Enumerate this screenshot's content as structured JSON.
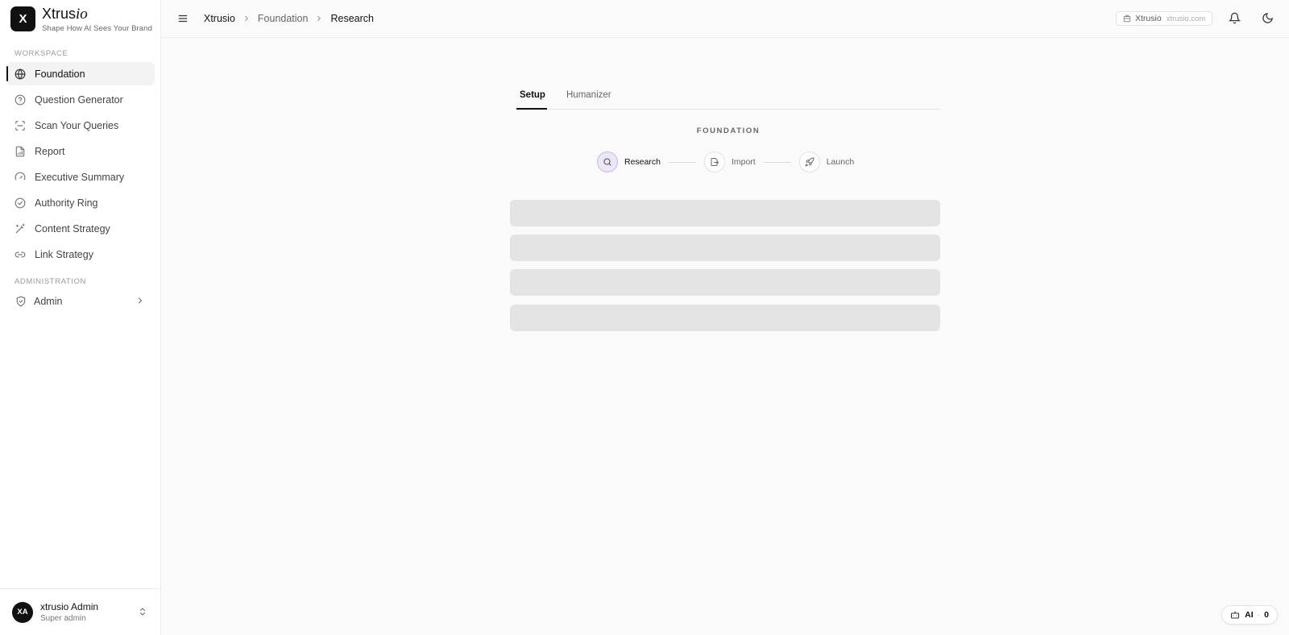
{
  "brand": {
    "logo_letter": "X",
    "name_main": "Xtrus",
    "name_suffix": "io",
    "tagline": "Shape How AI Sees Your Brand"
  },
  "sidebar": {
    "workspace_label": "WORKSPACE",
    "items": [
      {
        "label": "Foundation",
        "icon": "globe-icon",
        "active": true
      },
      {
        "label": "Question Generator",
        "icon": "question-circle-icon"
      },
      {
        "label": "Scan Your Queries",
        "icon": "scan-icon"
      },
      {
        "label": "Report",
        "icon": "file-chart-icon"
      },
      {
        "label": "Executive Summary",
        "icon": "gauge-icon"
      },
      {
        "label": "Authority Ring",
        "icon": "check-circle-icon"
      },
      {
        "label": "Content Strategy",
        "icon": "magic-wand-icon"
      },
      {
        "label": "Link Strategy",
        "icon": "link-icon"
      }
    ],
    "admin_label": "ADMINISTRATION",
    "admin_item": {
      "label": "Admin",
      "icon": "shield-icon"
    }
  },
  "user": {
    "initials": "XA",
    "name": "xtrusio Admin",
    "role": "Super admin"
  },
  "topbar": {
    "breadcrumbs": [
      "Xtrusio",
      "Foundation",
      "Research"
    ],
    "site_name": "Xtrusio",
    "site_domain": "xtrusio.com"
  },
  "main": {
    "tabs": [
      {
        "label": "Setup",
        "active": true
      },
      {
        "label": "Humanizer",
        "active": false
      }
    ],
    "section_label": "FOUNDATION",
    "steps": [
      {
        "label": "Research",
        "icon": "search-icon",
        "active": true
      },
      {
        "label": "Import",
        "icon": "import-icon",
        "active": false
      },
      {
        "label": "Launch",
        "icon": "rocket-icon",
        "active": false
      }
    ]
  },
  "ai_badge": {
    "label": "AI",
    "count": "0"
  }
}
